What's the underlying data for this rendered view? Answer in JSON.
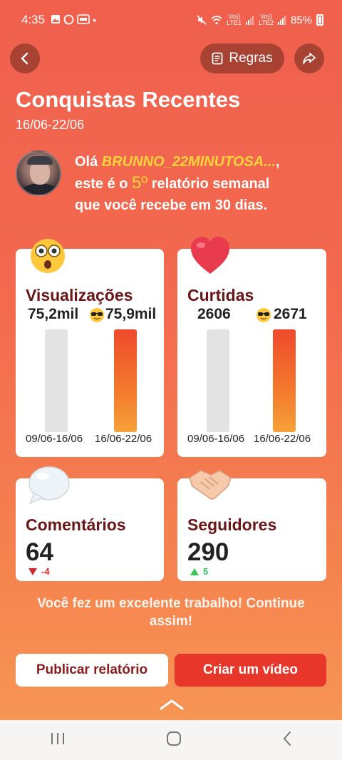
{
  "status_bar": {
    "time": "4:35",
    "network_1": "Vo))\nLTE1",
    "network_2": "Vo))\nLTE2",
    "battery": "85%"
  },
  "header": {
    "rules_label": "Regras",
    "title": "Conquistas Recentes",
    "date_range": "16/06-22/06"
  },
  "greeting": {
    "prefix": "Olá ",
    "username": "BRUNNO_22MINUTOSA...",
    "comma": ",",
    "line2_a": "este é o ",
    "rank": "5º",
    "line2_b": " relatório semanal",
    "line3": "que você recebe em 30 dias."
  },
  "cards": {
    "views": {
      "title": "Visualizações",
      "previous": "75,2mil",
      "current": "75,9mil",
      "period_prev": "09/06-16/06",
      "period_curr": "16/06-22/06"
    },
    "likes": {
      "title": "Curtidas",
      "previous": "2606",
      "current": "2671",
      "period_prev": "09/06-16/06",
      "period_curr": "16/06-22/06"
    },
    "comments": {
      "title": "Comentários",
      "value": "64",
      "delta": "-4"
    },
    "followers": {
      "title": "Seguidores",
      "value": "290",
      "delta": "5"
    }
  },
  "message": "Você fez um excelente trabalho! Continue assim!",
  "actions": {
    "publish": "Publicar relatório",
    "create": "Criar um vídeo"
  },
  "colors": {
    "accent": "#e8362a",
    "title_dark": "#6b1616",
    "down": "#d9262c",
    "up": "#34c759"
  }
}
